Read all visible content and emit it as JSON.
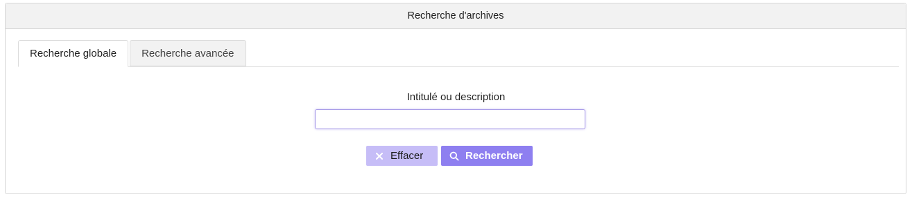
{
  "panel": {
    "title": "Recherche d'archives"
  },
  "tabs": [
    {
      "label": "Recherche globale",
      "active": true
    },
    {
      "label": "Recherche avancée",
      "active": false
    }
  ],
  "form": {
    "field_label": "Intitulé ou description",
    "input_value": "",
    "input_placeholder": ""
  },
  "buttons": {
    "clear_label": "Effacer",
    "clear_icon": "close-icon",
    "search_label": "Rechercher",
    "search_icon": "search-icon"
  },
  "colors": {
    "accent": "#8e7ff0",
    "accent_light": "#c6bdf7",
    "header_bg": "#f2f2f2"
  }
}
